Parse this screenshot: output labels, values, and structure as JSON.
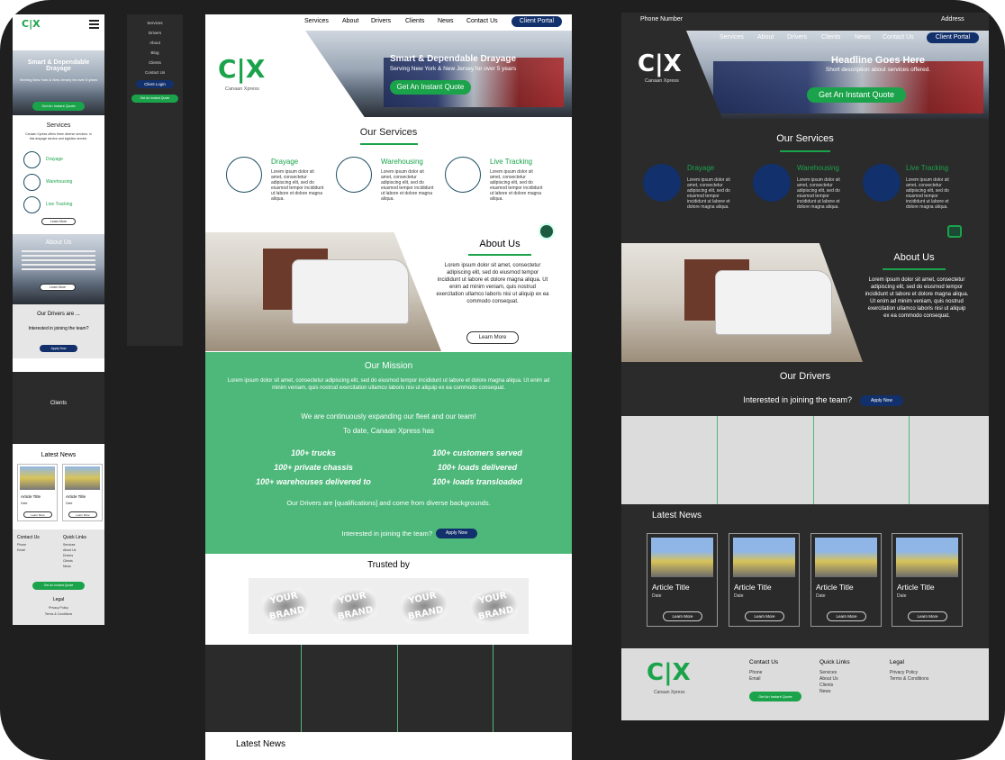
{
  "colors": {
    "green": "#1aa34a",
    "navy": "#12306b",
    "dark": "#2b2b2b",
    "mission": "#4db87a"
  },
  "mobile": {
    "hero_title": "Smart & Dependable Drayage",
    "hero_sub": "Serving New York & New Jersey for over 5 years",
    "quote": "Get An Instant Quote",
    "services_title": "Services",
    "services_text": "Canaan Xpress offers three diverse services. In this drayage service and logistics service.",
    "services": [
      "Drayage",
      "Warehousing",
      "Live Tracking"
    ],
    "learn_more": "Learn More",
    "about": "About Us",
    "drivers": "Our Drivers are ...",
    "interested": "Interested in joining the team?",
    "apply": "Apply Now",
    "clients": "Clients",
    "latest_news": "Latest News",
    "article": "Article Title",
    "date": "Date",
    "contact": "Contact Us",
    "phone": "Phone",
    "email": "Email",
    "quick": "Quick Links",
    "links": [
      "Services",
      "About Us",
      "Drivers",
      "Clients",
      "News"
    ],
    "legal": "Legal",
    "privacy": "Privacy Policy",
    "terms": "Terms & Conditions"
  },
  "menu": {
    "items": [
      "Services",
      "Drivers",
      "About",
      "Blog",
      "Clients",
      "Contact Us"
    ],
    "login": "Client Login",
    "quote": "Get An Instant Quote"
  },
  "v2": {
    "nav": [
      "Services",
      "About",
      "Drivers",
      "Clients",
      "News",
      "Contact Us"
    ],
    "portal": "Client Portal",
    "logo": "C|X",
    "logo_sub": "Canaan Xpress",
    "hero_title": "Smart & Dependable Drayage",
    "hero_sub": "Serving New York & New Jersey for over 5 years",
    "quote": "Get An Instant Quote",
    "services_title": "Our Services",
    "services": [
      {
        "name": "Drayage",
        "text": "Lorem ipsum dolor sit amet, consectetur adipiscing elit, sed do eiusmod tempor incididunt ut labore et dolore magna aliqua."
      },
      {
        "name": "Warehousing",
        "text": "Lorem ipsum dolor sit amet, consectetur adipiscing elit, sed do eiusmod tempor incididunt ut labore et dolore magna aliqua."
      },
      {
        "name": "Live Tracking",
        "text": "Lorem ipsum dolor sit amet, consectetur adipiscing elit, sed do eiusmod tempor incididunt ut labore et dolore magna aliqua."
      }
    ],
    "about_title": "About Us",
    "about_text": "Lorem ipsum dolor sit amet, consectetur adipiscing elit, sed do eiusmod tempor incididunt ut labore et dolore magna aliqua. Ut enim ad minim veniam, quis nostrud exercitation ullamco laboris nisi ut aliquip ex ea commodo consequat.",
    "learn_more": "Learn More",
    "mission_title": "Our Mission",
    "mission_text": "Lorem ipsum dolor sit amet, consectetur adipiscing elit, sed do eiusmod tempor incididunt ut labore et dolore magna aliqua. Ut enim ad minim veniam, quis nostrud exercitation ullamco laboris nisi ut aliquip ex ea commodo consequat.",
    "expanding": "We are continuously expanding our fleet and our team!",
    "to_date": "To date, Canaan Xpress has",
    "stats_left": [
      "100+ trucks",
      "100+ private chassis",
      "100+ warehouses delivered to"
    ],
    "stats_right": [
      "100+ customers served",
      "100+ loads delivered",
      "100+ loads transloaded"
    ],
    "drivers_text": "Our Drivers are [qualifications] and come from diverse backgrounds.",
    "interested": "Interested in joining the team?",
    "apply": "Apply Now",
    "trusted": "Trusted by",
    "brand": "YOUR BRAND",
    "latest_news": "Latest News"
  },
  "dark": {
    "phone": "Phone Number",
    "address": "Address",
    "nav": [
      "Services",
      "About",
      "Drivers",
      "Clients",
      "News",
      "Contact Us"
    ],
    "portal": "Client Portal",
    "logo": "C|X",
    "logo_sub": "Canaan Xpress",
    "hero_title": "Headline Goes Here",
    "hero_sub": "Short description about services offered.",
    "quote": "Get An Instant Quote",
    "services_title": "Our Services",
    "services": [
      "Drayage",
      "Warehousing",
      "Live Tracking"
    ],
    "service_text": "Lorem ipsum dolor sit amet, consectetur adipiscing elit, sed do eiusmod tempor incididunt ut labore et dolore magna aliqua.",
    "about_title": "About Us",
    "about_text": "Lorem ipsum dolor sit amet, consectetur adipiscing elit, sed do eiusmod tempor incididunt ut labore et dolore magna aliqua. Ut enim ad minim veniam, quis nostrud exercitation ullamco laboris nisi ut aliquip ex ea commodo consequat.",
    "drivers_title": "Our Drivers",
    "interested": "Interested in joining the team?",
    "apply": "Apply Now",
    "latest_news": "Latest News",
    "article": "Article Title",
    "date": "Date",
    "learn_more": "Learn More",
    "contact": "Contact Us",
    "phone_l": "Phone",
    "email_l": "Email",
    "quote_btn": "Get An Instant Quote",
    "quick": "Quick Links",
    "links": [
      "Services",
      "About Us",
      "Clients",
      "News"
    ],
    "legal": "Legal",
    "privacy": "Privacy Policy",
    "terms": "Terms & Conditions"
  }
}
